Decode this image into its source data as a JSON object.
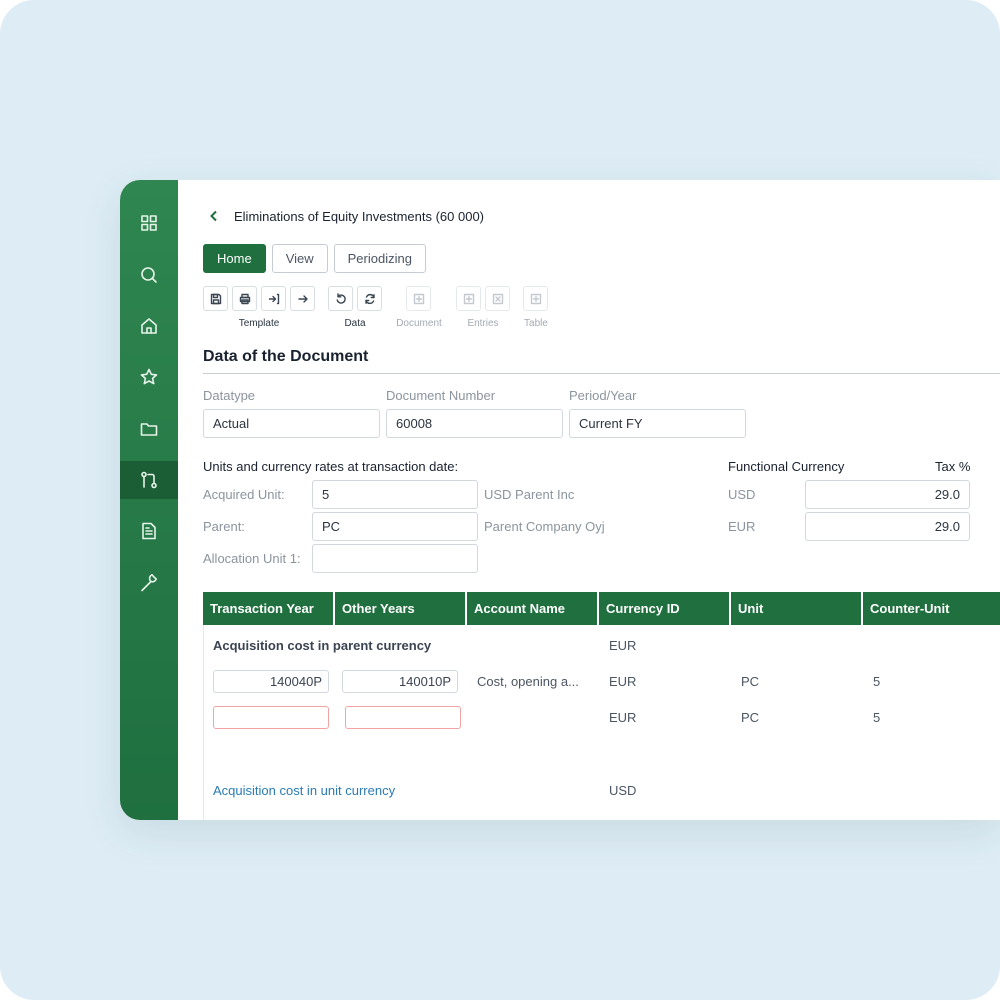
{
  "sidebar": {
    "items": [
      {
        "icon": "grid-icon"
      },
      {
        "icon": "search-icon"
      },
      {
        "icon": "home-icon"
      },
      {
        "icon": "star-icon"
      },
      {
        "icon": "folder-icon"
      },
      {
        "icon": "git-pull-request-icon",
        "active": true
      },
      {
        "icon": "document-icon"
      },
      {
        "icon": "wrench-icon"
      }
    ]
  },
  "header": {
    "title": "Eliminations of Equity Investments (60 000)"
  },
  "tabs": [
    {
      "label": "Home",
      "active": true
    },
    {
      "label": "View"
    },
    {
      "label": "Periodizing"
    }
  ],
  "toolbar": {
    "groups": [
      {
        "label": "Template",
        "disabled": false
      },
      {
        "label": "Data",
        "disabled": false
      },
      {
        "label": "Document",
        "disabled": true
      },
      {
        "label": "Entries",
        "disabled": true
      },
      {
        "label": "Table",
        "disabled": true
      }
    ]
  },
  "document": {
    "section_title": "Data of the Document",
    "datatype_label": "Datatype",
    "datatype_value": "Actual",
    "docnum_label": "Document Number",
    "docnum_value": "60008",
    "period_label": "Period/Year",
    "period_value": "Current FY"
  },
  "units": {
    "heading": "Units and currency rates at transaction date:",
    "acquired_label": "Acquired Unit:",
    "acquired_value": "5",
    "acquired_name": "USD Parent Inc",
    "parent_label": "Parent:",
    "parent_value": "PC",
    "parent_name": "Parent Company Oyj",
    "alloc_label": "Allocation Unit 1:",
    "alloc_value": ""
  },
  "currency": {
    "heading": "Functional Currency",
    "tax_heading": "Tax %",
    "rows": [
      {
        "currency": "USD",
        "tax": "29.0"
      },
      {
        "currency": "EUR",
        "tax": "29.0"
      }
    ]
  },
  "table": {
    "columns": [
      "Transaction Year",
      "Other Years",
      "Account Name",
      "Currency ID",
      "Unit",
      "Counter-Unit"
    ],
    "group1_label": "Acquisition cost in parent currency",
    "group1_currency": "EUR",
    "row1": {
      "transaction_year": "140040P",
      "other_years": "140010P",
      "account": "Cost, opening a...",
      "currency": "EUR",
      "unit": "PC",
      "counter_unit": "5"
    },
    "row2": {
      "transaction_year": "",
      "other_years": "",
      "currency": "EUR",
      "unit": "PC",
      "counter_unit": "5"
    },
    "group2_label": "Acquisition cost in unit currency",
    "group2_currency": "USD"
  }
}
